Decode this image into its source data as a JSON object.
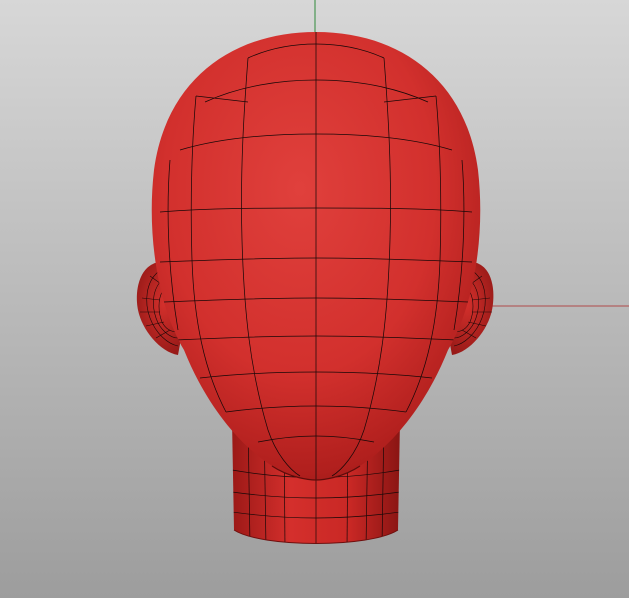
{
  "viewport": {
    "type": "3d-perspective-viewport",
    "shading": "shaded",
    "wireframe_on_shaded": true,
    "model": "head-mesh",
    "colors": {
      "background_top": "#d7d7d7",
      "background_bottom": "#9d9d9d",
      "model_base": "#d8302e",
      "model_highlight": "#e24a44",
      "model_shadow": "#8e1412",
      "wire": "#1a0808",
      "axis_x": "#b04a4a",
      "axis_y": "#2f8a3a"
    }
  }
}
